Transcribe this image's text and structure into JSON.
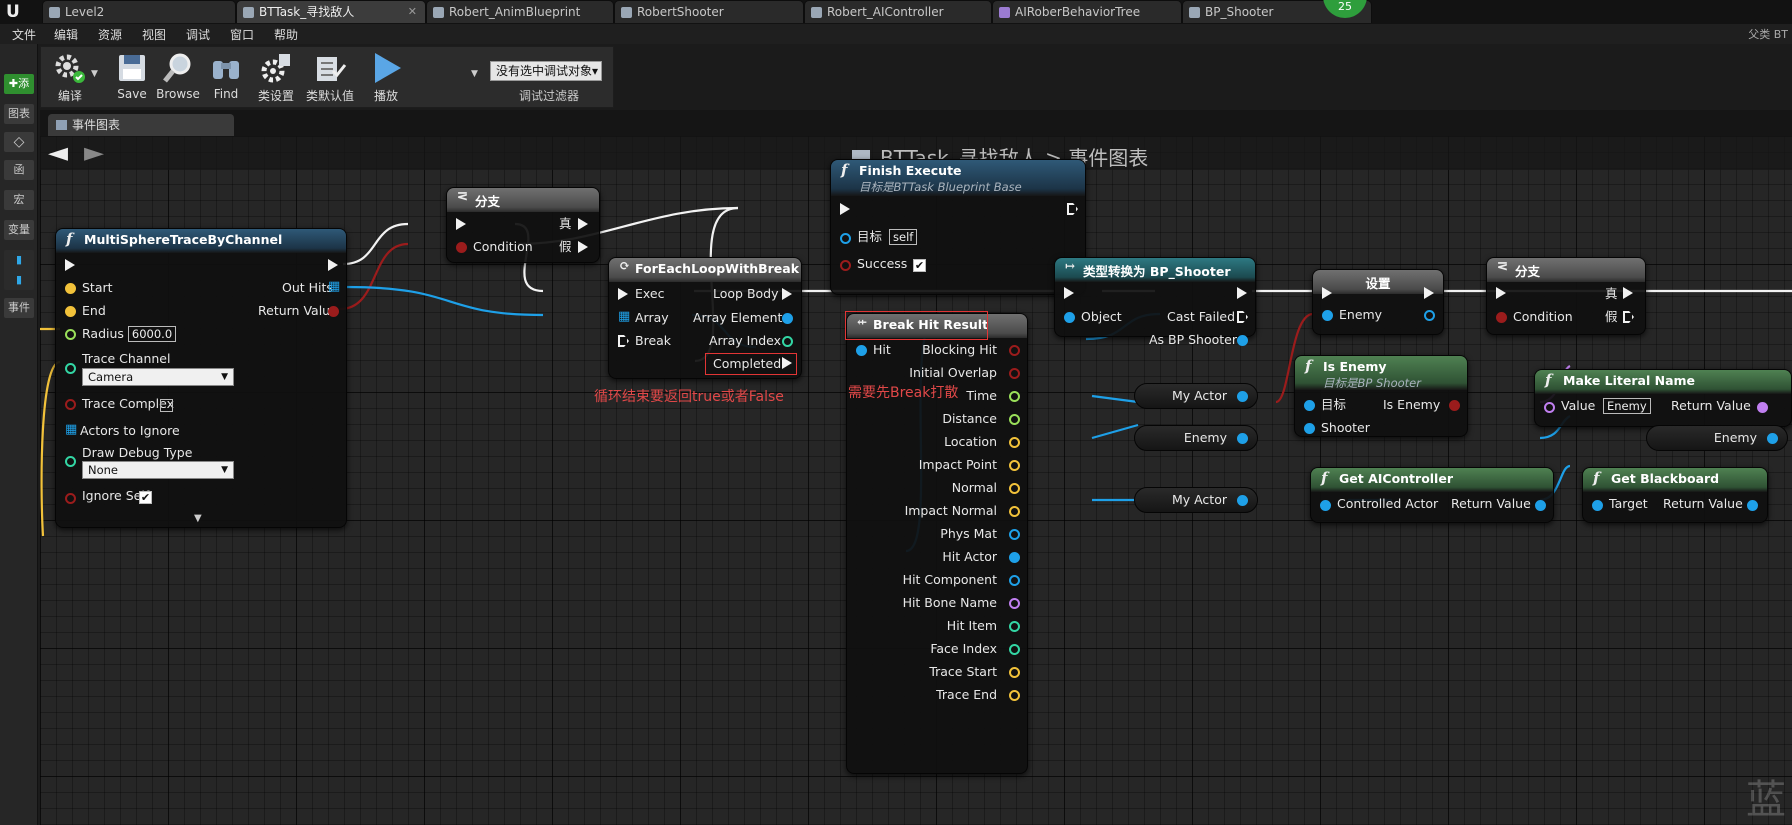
{
  "tabs": [
    {
      "label": "Level2",
      "active": false
    },
    {
      "label": "BTTask_寻找敌人",
      "active": true
    },
    {
      "label": "Robert_AnimBlueprint",
      "active": false
    },
    {
      "label": "RobertShooter",
      "active": false
    },
    {
      "label": "Robert_AIController",
      "active": false
    },
    {
      "label": "AIRoberBehaviorTree",
      "active": false
    },
    {
      "label": "BP_Shooter",
      "active": false
    }
  ],
  "badge": "25",
  "parent_class": "父类 BT",
  "menu": [
    "文件",
    "编辑",
    "资源",
    "视图",
    "调试",
    "窗口",
    "帮助"
  ],
  "left_panel": {
    "add_label": "添",
    "items": [
      "图表",
      "函",
      "宏",
      "变量",
      "事件"
    ]
  },
  "toolbar": {
    "compile": "编译",
    "save": "Save",
    "browse": "Browse",
    "find": "Find",
    "class_settings": "类设置",
    "class_defaults": "类默认值",
    "play": "播放",
    "debug_object": "没有选中调试对象▾",
    "debug_filter": "调试过滤器"
  },
  "graph_tab": "事件图表",
  "breadcrumb": {
    "asset": "BTTask_寻找敌人",
    "sep": ">",
    "graph": "事件图表"
  },
  "nodes": {
    "trace": {
      "title": "MultiSphereTraceByChannel",
      "start": "Start",
      "end": "End",
      "radius_label": "Radius",
      "radius_value": "6000.0",
      "trace_channel_label": "Trace Channel",
      "trace_channel_value": "Camera",
      "trace_complex": "Trace Complex",
      "actors_to_ignore": "Actors to Ignore",
      "draw_debug_label": "Draw Debug Type",
      "draw_debug_value": "None",
      "ignore_self": "Ignore Self",
      "out_hits": "Out Hits",
      "return_value": "Return Value"
    },
    "branch1": {
      "title": "分支",
      "condition": "Condition",
      "true_label": "真",
      "false_label": "假"
    },
    "foreach": {
      "title": "ForEachLoopWithBreak",
      "exec": "Exec",
      "array": "Array",
      "break_label": "Break",
      "loop_body": "Loop Body",
      "array_element": "Array Element",
      "array_index": "Array Index",
      "completed": "Completed"
    },
    "finish": {
      "title": "Finish Execute",
      "subtitle": "目标是BTTask Blueprint Base",
      "target": "目标",
      "target_value": "self",
      "success": "Success"
    },
    "breakhit": {
      "title": "Break Hit Result",
      "hit": "Hit",
      "outputs": [
        "Blocking Hit",
        "Initial Overlap",
        "Time",
        "Distance",
        "Location",
        "Impact Point",
        "Normal",
        "Impact Normal",
        "Phys Mat",
        "Hit Actor",
        "Hit Component",
        "Hit Bone Name",
        "Hit Item",
        "Face Index",
        "Trace Start",
        "Trace End"
      ]
    },
    "cast": {
      "title": "类型转换为 BP_Shooter",
      "object": "Object",
      "cast_failed": "Cast Failed",
      "as_shooter": "As BP Shooter"
    },
    "set": {
      "title": "设置",
      "enemy": "Enemy"
    },
    "branch2": {
      "title": "分支",
      "condition": "Condition",
      "true_label": "真",
      "false_label": "假"
    },
    "isenemy": {
      "title": "Is Enemy",
      "subtitle": "目标是BP Shooter",
      "target": "目标",
      "shooter": "Shooter",
      "is_enemy": "Is Enemy"
    },
    "makename": {
      "title": "Make Literal Name",
      "value": "Value",
      "value_input": "Enemy",
      "return_value": "Return Value"
    },
    "getai": {
      "title": "Get AIController",
      "controlled_actor": "Controlled Actor",
      "return_value": "Return Value"
    },
    "getbb": {
      "title": "Get Blackboard",
      "target": "Target",
      "return_value": "Return Value"
    }
  },
  "vars": {
    "my_actor_1": "My Actor",
    "enemy_1": "Enemy",
    "my_actor_2": "My Actor",
    "enemy_2": "Enemy"
  },
  "notes": {
    "completed_note": "循环结束要返回true或者False",
    "break_note": "需要先Break打散"
  },
  "watermark": "蓝",
  "colors": {
    "exec": "#f2f2f2",
    "object": "#1ea0e8",
    "bool": "#9b1c1c",
    "float": "#9ae05a",
    "vector": "#f2c23a",
    "int": "#33d6a4",
    "name": "#c07ff0",
    "struct": "#1ea0e8",
    "accent_red": "#e23535"
  }
}
